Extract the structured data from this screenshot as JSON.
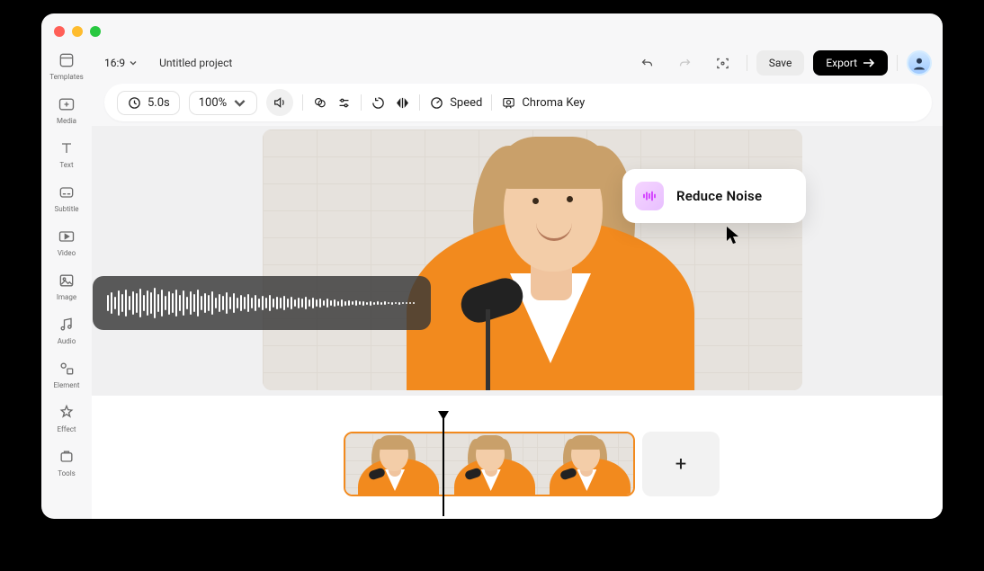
{
  "sidebar": {
    "items": [
      {
        "label": "Templates"
      },
      {
        "label": "Media"
      },
      {
        "label": "Text"
      },
      {
        "label": "Subtitle"
      },
      {
        "label": "Video"
      },
      {
        "label": "Image"
      },
      {
        "label": "Audio"
      },
      {
        "label": "Element"
      },
      {
        "label": "Effect"
      },
      {
        "label": "Tools"
      }
    ]
  },
  "topbar": {
    "ratio": "16:9",
    "project_title": "Untitled project",
    "save_label": "Save",
    "export_label": "Export"
  },
  "toolbar": {
    "duration": "5.0s",
    "zoom": "100%",
    "speed_label": "Speed",
    "chroma_label": "Chroma Key"
  },
  "popup": {
    "label": "Reduce Noise"
  },
  "timeline": {
    "add_label": "+"
  }
}
